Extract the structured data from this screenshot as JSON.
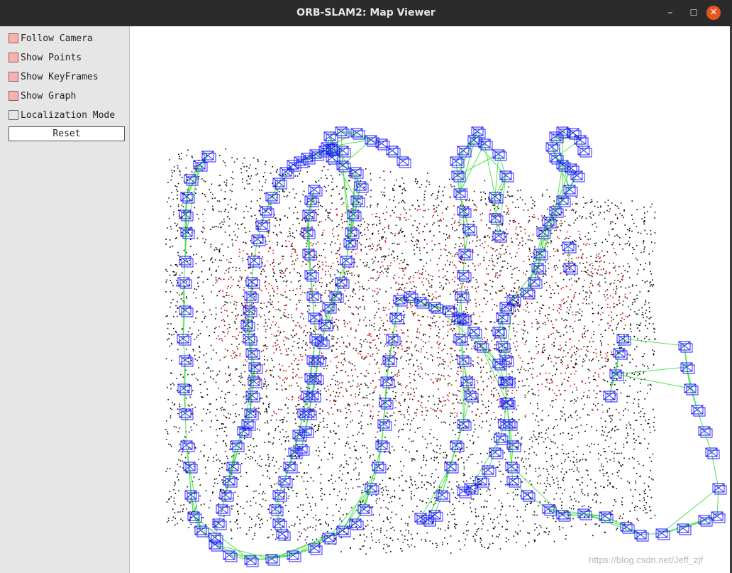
{
  "window": {
    "title": "ORB-SLAM2: Map Viewer",
    "minimize_icon": "minimize-icon",
    "maximize_icon": "maximize-icon",
    "close_icon": "close-icon",
    "min_glyph": "–",
    "max_glyph": "☐",
    "close_glyph": "✕"
  },
  "panel": {
    "options": [
      {
        "label": "Follow Camera",
        "checked": true
      },
      {
        "label": "Show Points",
        "checked": true
      },
      {
        "label": "Show KeyFrames",
        "checked": true
      },
      {
        "label": "Show Graph",
        "checked": true
      },
      {
        "label": "Localization Mode",
        "checked": false
      }
    ],
    "reset_label": "Reset"
  },
  "viewer": {
    "watermark": "https://blog.csdn.net/Jeff_zjf",
    "colors": {
      "map_points": "#000000",
      "local_points": "#e00000",
      "keyframes": "#1a1aff",
      "graph": "#33dd33",
      "background": "#ffffff"
    }
  }
}
